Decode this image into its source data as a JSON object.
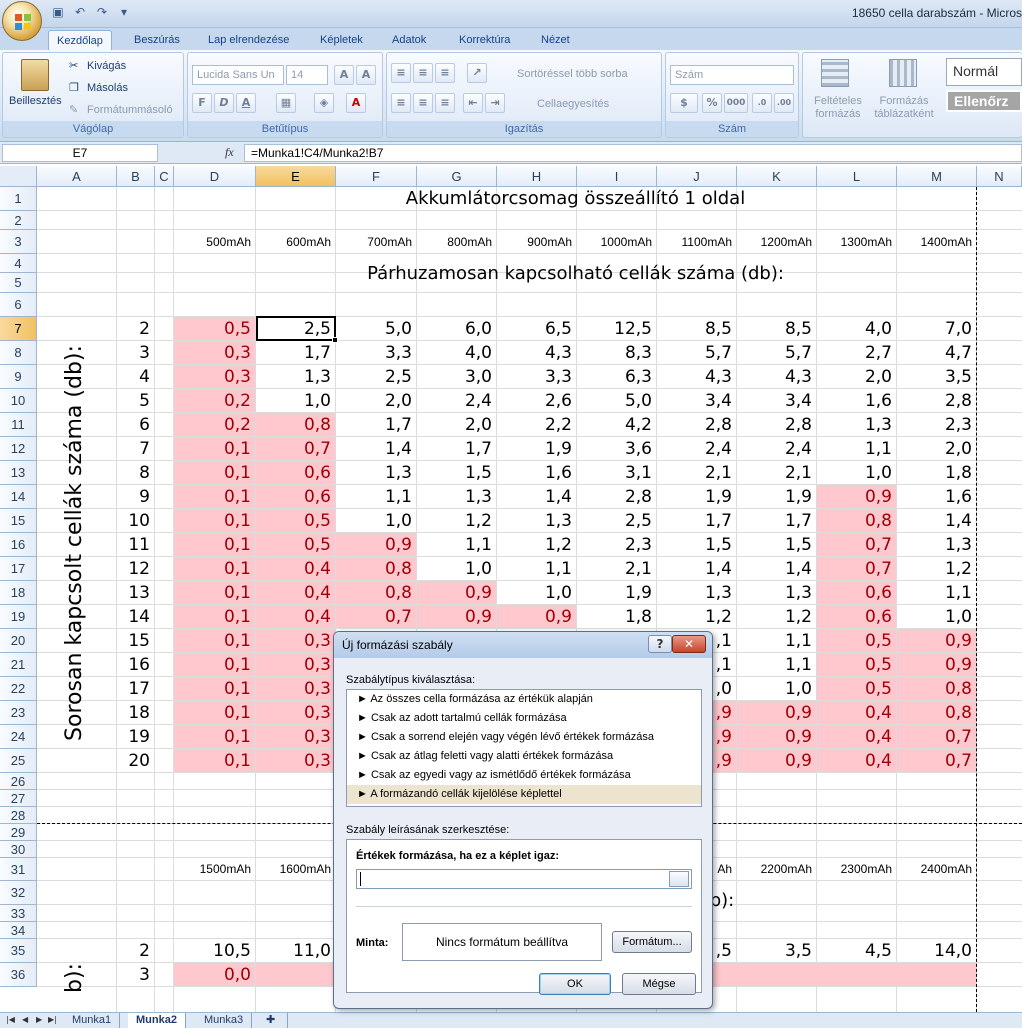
{
  "window": {
    "title": "18650 cella darabszám - Micros"
  },
  "tabs": [
    "Kezdőlap",
    "Beszúrás",
    "Lap elrendezése",
    "Képletek",
    "Adatok",
    "Korrektúra",
    "Nézet"
  ],
  "ribbon": {
    "clipboard": {
      "paste": "Beillesztés",
      "cut": "Kivágás",
      "copy": "Másolás",
      "format_painter": "Formátummásoló",
      "label": "Vágólap"
    },
    "font": {
      "name": "Lucida Sans Un",
      "size": "14",
      "bold": "F",
      "italic": "D",
      "underline": "A",
      "label": "Betűtípus"
    },
    "alignment": {
      "wrap": "Sortöréssel több sorba",
      "merge": "Cellaegyesítés",
      "label": "Igazítás"
    },
    "number": {
      "format": "Szám",
      "percent": "%",
      "thousands": "000",
      "label": "Szám"
    },
    "styles": {
      "conditional": "Feltételes formázás",
      "table": "Formázás táblázatként",
      "normal": "Normál",
      "check": "Ellenőrz"
    }
  },
  "formula_bar": {
    "name_box": "E7",
    "fx": "fx",
    "formula": "=Munka1!C4/Munka2!B7"
  },
  "columns": [
    "A",
    "B",
    "C",
    "D",
    "E",
    "F",
    "G",
    "H",
    "I",
    "J",
    "K",
    "L",
    "M",
    "N"
  ],
  "sheet": {
    "title1": "Akkumlátorcsomag összeállító 1 oldal",
    "capacities1": [
      "500mAh",
      "600mAh",
      "700mAh",
      "800mAh",
      "900mAh",
      "1000mAh",
      "1100mAh",
      "1200mAh",
      "1300mAh",
      "1400mAh"
    ],
    "parallel_label": "Párhuzamosan kapcsolható cellák száma (db):",
    "series_label": "Sorosan kapcsolt cellák száma (db):",
    "rows1": [
      {
        "n": "2",
        "v": [
          "0,5",
          "2,5",
          "5,0",
          "6,0",
          "6,5",
          "12,5",
          "8,5",
          "8,5",
          "4,0",
          "7,0"
        ]
      },
      {
        "n": "3",
        "v": [
          "0,3",
          "1,7",
          "3,3",
          "4,0",
          "4,3",
          "8,3",
          "5,7",
          "5,7",
          "2,7",
          "4,7"
        ]
      },
      {
        "n": "4",
        "v": [
          "0,3",
          "1,3",
          "2,5",
          "3,0",
          "3,3",
          "6,3",
          "4,3",
          "4,3",
          "2,0",
          "3,5"
        ]
      },
      {
        "n": "5",
        "v": [
          "0,2",
          "1,0",
          "2,0",
          "2,4",
          "2,6",
          "5,0",
          "3,4",
          "3,4",
          "1,6",
          "2,8"
        ]
      },
      {
        "n": "6",
        "v": [
          "0,2",
          "0,8",
          "1,7",
          "2,0",
          "2,2",
          "4,2",
          "2,8",
          "2,8",
          "1,3",
          "2,3"
        ]
      },
      {
        "n": "7",
        "v": [
          "0,1",
          "0,7",
          "1,4",
          "1,7",
          "1,9",
          "3,6",
          "2,4",
          "2,4",
          "1,1",
          "2,0"
        ]
      },
      {
        "n": "8",
        "v": [
          "0,1",
          "0,6",
          "1,3",
          "1,5",
          "1,6",
          "3,1",
          "2,1",
          "2,1",
          "1,0",
          "1,8"
        ]
      },
      {
        "n": "9",
        "v": [
          "0,1",
          "0,6",
          "1,1",
          "1,3",
          "1,4",
          "2,8",
          "1,9",
          "1,9",
          "0,9",
          "1,6"
        ]
      },
      {
        "n": "10",
        "v": [
          "0,1",
          "0,5",
          "1,0",
          "1,2",
          "1,3",
          "2,5",
          "1,7",
          "1,7",
          "0,8",
          "1,4"
        ]
      },
      {
        "n": "11",
        "v": [
          "0,1",
          "0,5",
          "0,9",
          "1,1",
          "1,2",
          "2,3",
          "1,5",
          "1,5",
          "0,7",
          "1,3"
        ]
      },
      {
        "n": "12",
        "v": [
          "0,1",
          "0,4",
          "0,8",
          "1,0",
          "1,1",
          "2,1",
          "1,4",
          "1,4",
          "0,7",
          "1,2"
        ]
      },
      {
        "n": "13",
        "v": [
          "0,1",
          "0,4",
          "0,8",
          "0,9",
          "1,0",
          "1,9",
          "1,3",
          "1,3",
          "0,6",
          "1,1"
        ]
      },
      {
        "n": "14",
        "v": [
          "0,1",
          "0,4",
          "0,7",
          "0,9",
          "0,9",
          "1,8",
          "1,2",
          "1,2",
          "0,6",
          "1,0"
        ]
      },
      {
        "n": "15",
        "v": [
          "0,1",
          "0,3",
          "",
          "",
          "",
          "",
          ",1",
          "1,1",
          "0,5",
          "0,9"
        ]
      },
      {
        "n": "16",
        "v": [
          "0,1",
          "0,3",
          "",
          "",
          "",
          "",
          ",1",
          "1,1",
          "0,5",
          "0,9"
        ]
      },
      {
        "n": "17",
        "v": [
          "0,1",
          "0,3",
          "",
          "",
          "",
          "",
          ",0",
          "1,0",
          "0,5",
          "0,8"
        ]
      },
      {
        "n": "18",
        "v": [
          "0,1",
          "0,3",
          "",
          "",
          "",
          "",
          ",9",
          "0,9",
          "0,4",
          "0,8"
        ]
      },
      {
        "n": "19",
        "v": [
          "0,1",
          "0,3",
          "",
          "",
          "",
          "",
          ",9",
          "0,9",
          "0,4",
          "0,7"
        ]
      },
      {
        "n": "20",
        "v": [
          "0,1",
          "0,3",
          "",
          "",
          "",
          "",
          ",9",
          "0,9",
          "0,4",
          "0,7"
        ]
      }
    ],
    "title2_partial": "A",
    "capacities2_visible": [
      "1500mAh",
      "1600mAh",
      "",
      "",
      "",
      "",
      "Ah",
      "2200mAh",
      "2300mAh",
      "2400mAh"
    ],
    "parallel_label2_partial": "ma (db):",
    "series_label2_partial": "b):",
    "row35": {
      "n": "2",
      "v": [
        "10,5",
        "11,0",
        "",
        "",
        "",
        "",
        ",5",
        "3,5",
        "4,5",
        "14,0"
      ]
    },
    "row36": {
      "n": "3",
      "v": [
        "0,0"
      ]
    }
  },
  "sheet_tabs": [
    "Munka1",
    "Munka2",
    "Munka3"
  ],
  "dialog": {
    "title": "Új formázási szabály",
    "help": "?",
    "close": "✕",
    "select_label": "Szabálytípus kiválasztása:",
    "rules": [
      "► Az összes cella formázása az értékük alapján",
      "► Csak az adott tartalmú cellák formázása",
      "► Csak a sorrend elején vagy végén lévő értékek formázása",
      "► Csak az átlag feletti vagy alatti értékek formázása",
      "► Csak az egyedi vagy az ismétlődő értékek formázása",
      "► A formázandó cellák kijelölése képlettel"
    ],
    "edit_label": "Szabály leírásának szerkesztése:",
    "formula_label": "Értékek formázása, ha ez a képlet igaz:",
    "preview_label": "Minta:",
    "preview_text": "Nincs formátum beállítva",
    "format_button": "Formátum...",
    "ok": "OK",
    "cancel": "Mégse"
  }
}
